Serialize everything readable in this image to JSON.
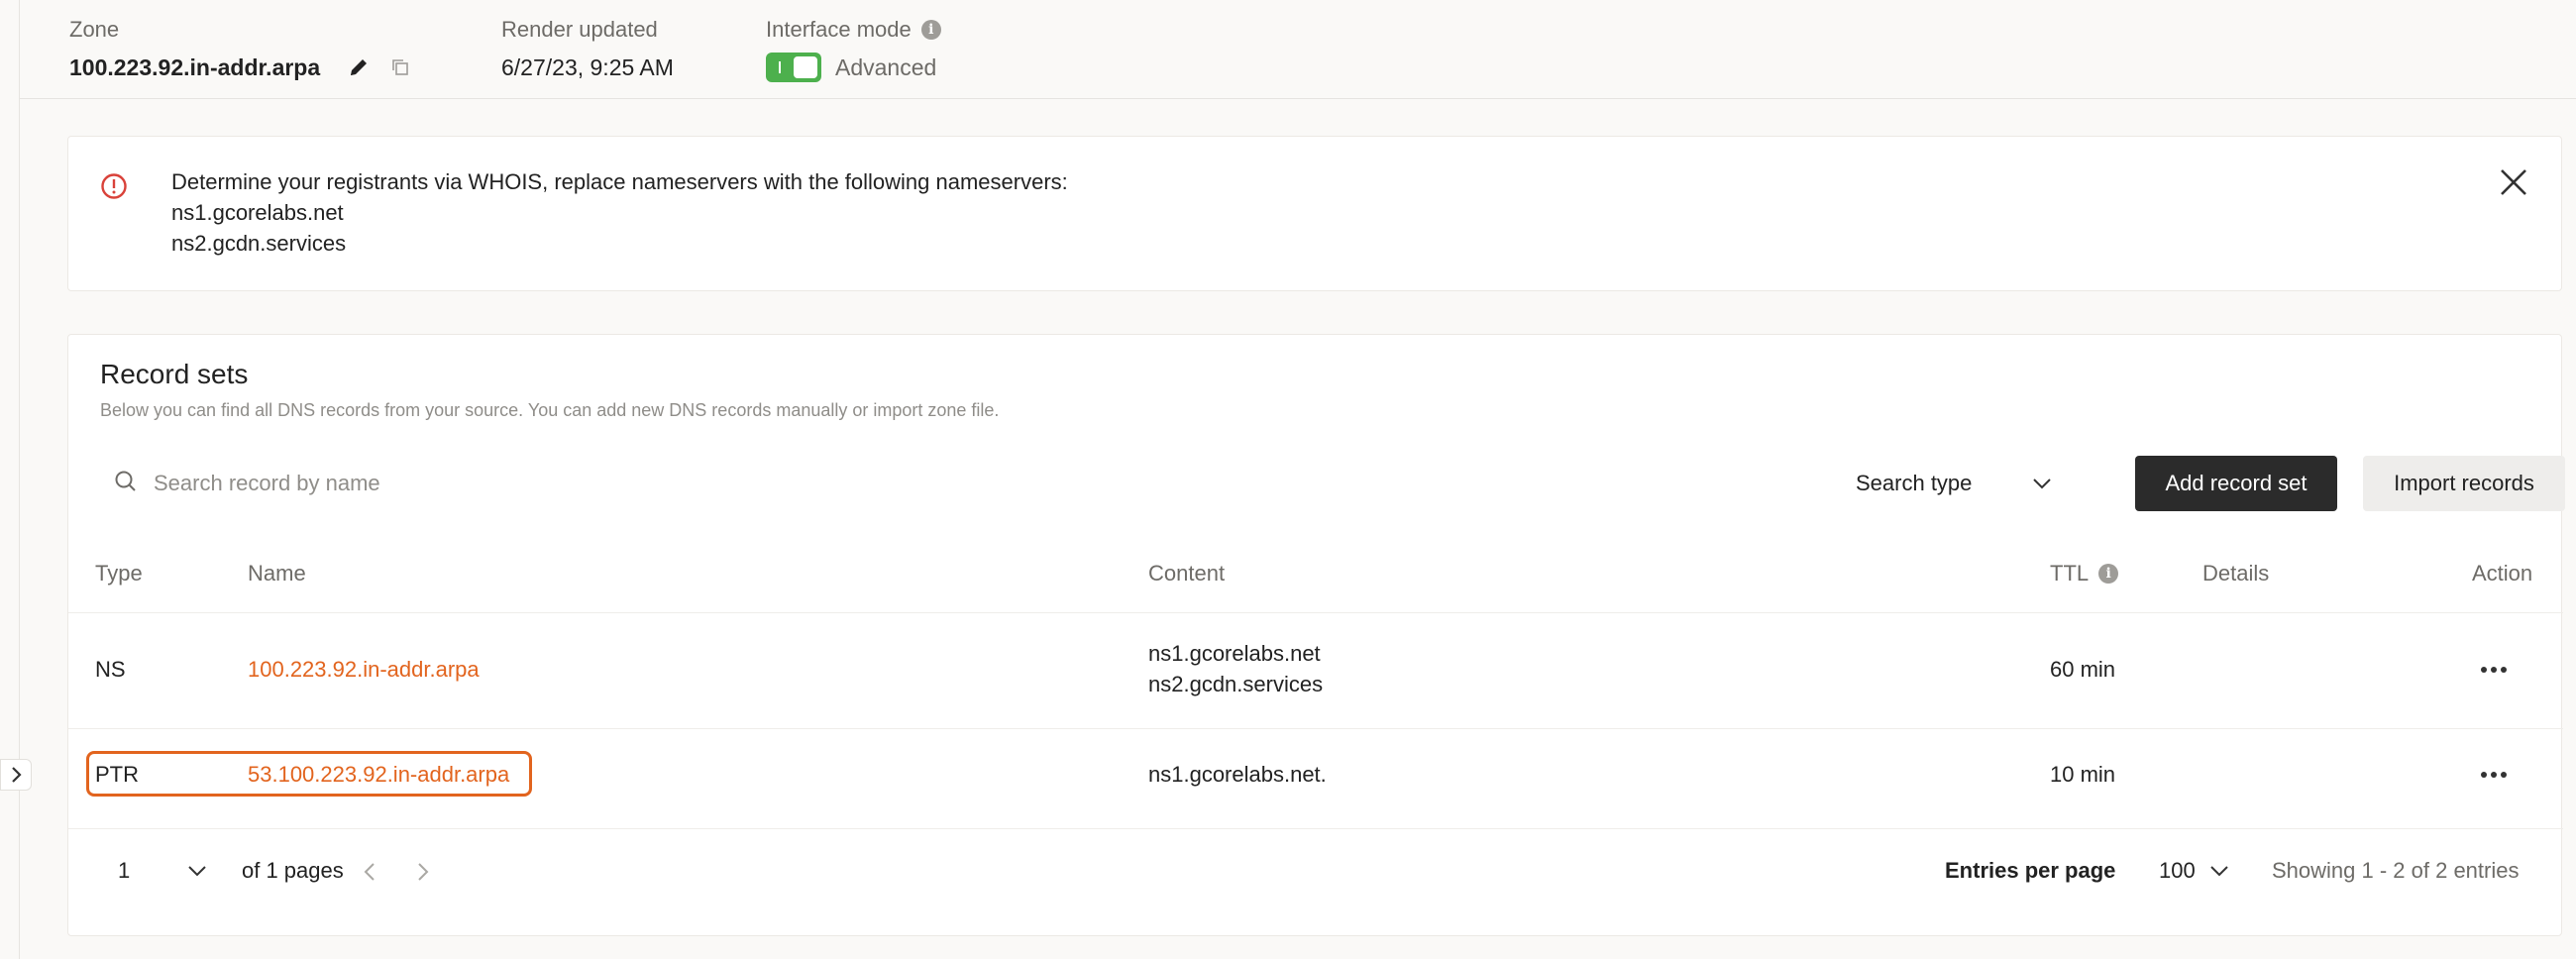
{
  "header": {
    "zone_label": "Zone",
    "zone_value": "100.223.92.in-addr.arpa",
    "render_label": "Render updated",
    "render_value": "6/27/23, 9:25 AM",
    "mode_label": "Interface mode",
    "mode_value": "Advanced",
    "mode_enabled": true
  },
  "alert": {
    "message": "Determine your registrants via WHOIS, replace nameservers with the following nameservers:",
    "nameservers": [
      "ns1.gcorelabs.net",
      "ns2.gcdn.services"
    ]
  },
  "records": {
    "title": "Record sets",
    "subtitle": "Below you can find all DNS records from your source. You can add new DNS records manually or import zone file.",
    "search_placeholder": "Search record by name",
    "type_select": "Search type",
    "add_button": "Add record set",
    "import_button": "Import records",
    "columns": {
      "type": "Type",
      "name": "Name",
      "content": "Content",
      "ttl": "TTL",
      "details": "Details",
      "action": "Action"
    },
    "rows": [
      {
        "type": "NS",
        "name": "100.223.92.in-addr.arpa",
        "content": [
          "ns1.gcorelabs.net",
          "ns2.gcdn.services"
        ],
        "ttl": "60 min"
      },
      {
        "type": "PTR",
        "name": "53.100.223.92.in-addr.arpa",
        "content": [
          "ns1.gcorelabs.net."
        ],
        "ttl": "10 min"
      }
    ]
  },
  "pagination": {
    "page": "1",
    "of_pages": "of 1 pages",
    "entries_label": "Entries per page",
    "entries_value": "100",
    "showing": "Showing 1 - 2 of 2 entries"
  },
  "colors": {
    "accent": "#e2641e",
    "toggle_on": "#4db04d",
    "alert_icon": "#d9423a",
    "primary_button": "#2b2b2b"
  }
}
